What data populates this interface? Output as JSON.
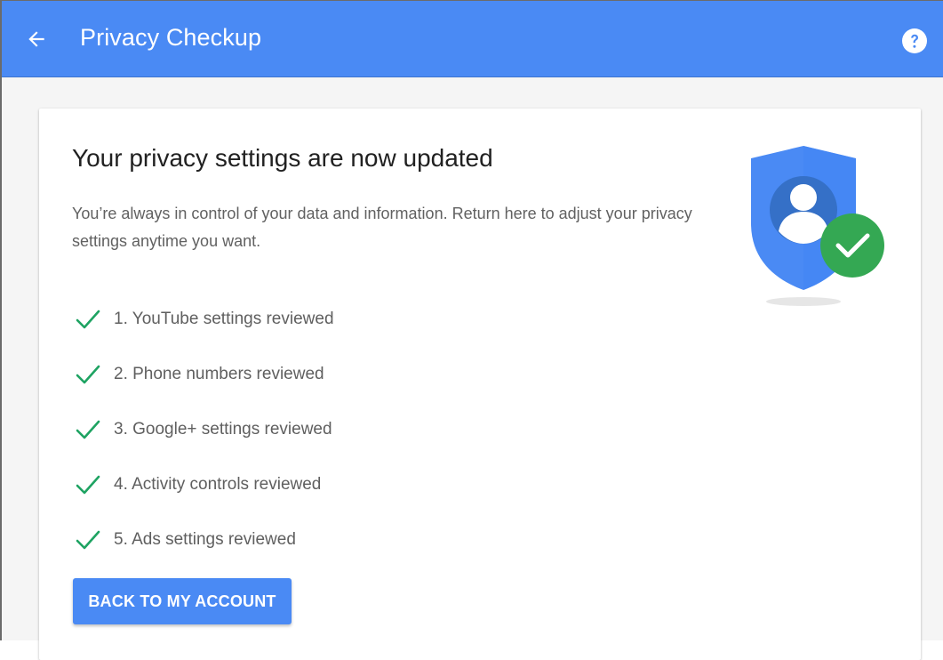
{
  "appbar": {
    "back_icon": "arrow-back-icon",
    "title": "Privacy Checkup",
    "help_icon": "help-circle-icon",
    "color": "#4a8af4"
  },
  "card": {
    "title": "Your privacy settings are now updated",
    "description": "You’re always in control of your data and information. Return here to adjust your privacy settings anytime you want.",
    "illustration": "shield-user-check-icon",
    "checklist": [
      {
        "label": "1. YouTube settings reviewed",
        "icon": "check-icon"
      },
      {
        "label": "2. Phone numbers reviewed",
        "icon": "check-icon"
      },
      {
        "label": "3. Google+ settings reviewed",
        "icon": "check-icon"
      },
      {
        "label": "4. Activity controls reviewed",
        "icon": "check-icon"
      },
      {
        "label": "5. Ads settings reviewed",
        "icon": "check-icon"
      }
    ],
    "button_label": "BACK TO MY ACCOUNT"
  },
  "colors": {
    "accent": "#4a8af4",
    "check_green": "#1ea362",
    "badge_green": "#34a853",
    "shield_dark": "#3570c7"
  }
}
